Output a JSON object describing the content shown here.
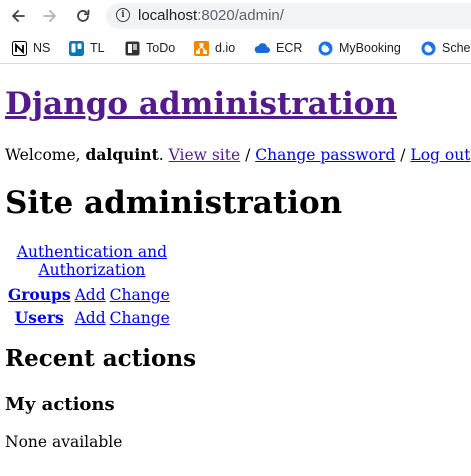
{
  "browser": {
    "url_host": "localhost",
    "url_rest": ":8020/admin/",
    "bookmarks": [
      {
        "label": "NS",
        "icon": "notion-icon"
      },
      {
        "label": "TL",
        "icon": "trello-icon"
      },
      {
        "label": "ToDo",
        "icon": "todo-icon"
      },
      {
        "label": "d.io",
        "icon": "drawio-icon"
      },
      {
        "label": "ECR",
        "icon": "cloud-icon"
      },
      {
        "label": "MyBooking",
        "icon": "mybooking-icon"
      },
      {
        "label": "Sche",
        "icon": "schedule-icon"
      }
    ]
  },
  "header": {
    "site_title": "Django administration",
    "welcome_prefix": "Welcome, ",
    "username": "dalquint",
    "welcome_suffix": ". ",
    "view_site": "View site",
    "separator": " / ",
    "change_password": "Change password",
    "log_out": "Log out"
  },
  "main": {
    "title": "Site administration",
    "app": {
      "name": "Authentication and Authorization",
      "models": [
        {
          "name": "Groups",
          "add": "Add",
          "change": "Change"
        },
        {
          "name": "Users",
          "add": "Add",
          "change": "Change"
        }
      ]
    }
  },
  "sidebar": {
    "recent_title": "Recent actions",
    "my_actions_title": "My actions",
    "empty_text": "None available"
  },
  "colors": {
    "link": "#0000ee",
    "visited_link": "#551a8b",
    "omnibox_bg": "#f1f3f4"
  }
}
